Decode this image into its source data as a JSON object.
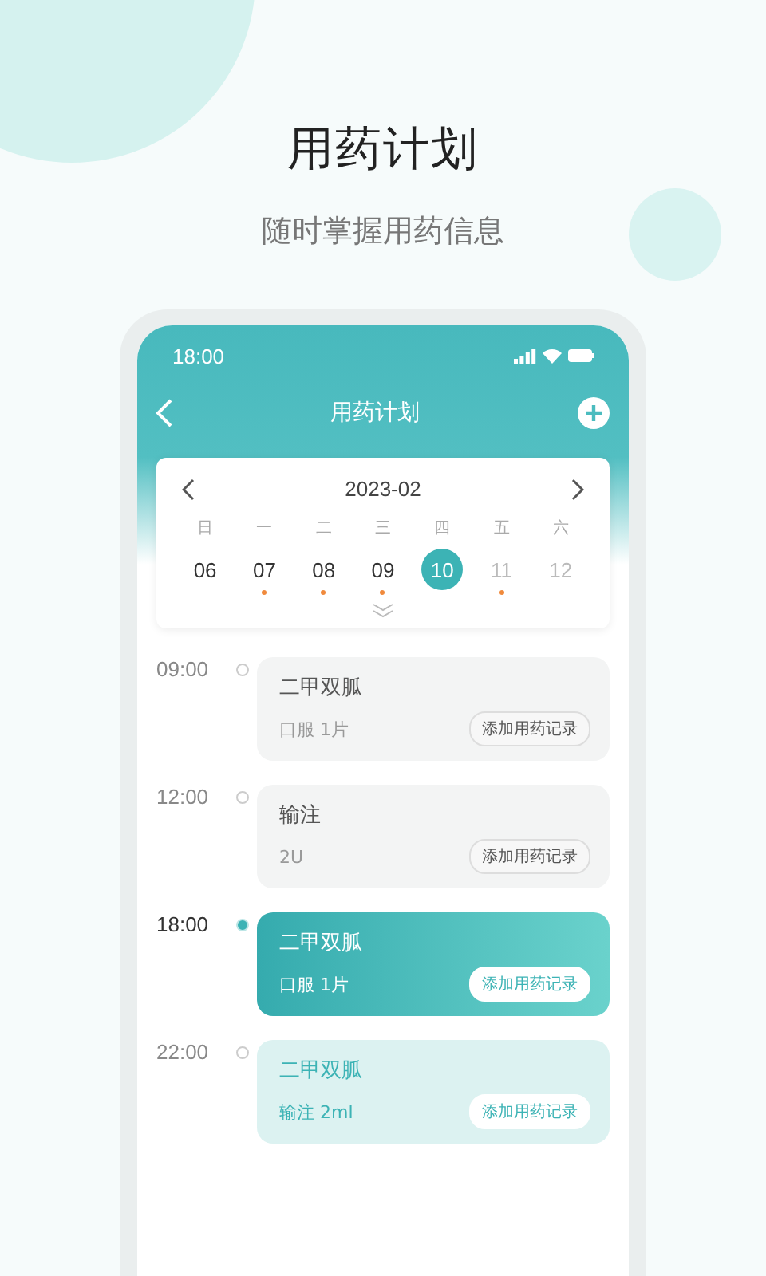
{
  "headline": "用药计划",
  "subheadline": "随时掌握用药信息",
  "status_bar": {
    "time": "18:00"
  },
  "nav": {
    "title": "用药计划"
  },
  "calendar": {
    "month": "2023-02",
    "weekdays": [
      "日",
      "一",
      "二",
      "三",
      "四",
      "五",
      "六"
    ],
    "days": [
      {
        "label": "06",
        "selected": false,
        "dimmed": false,
        "dot": false
      },
      {
        "label": "07",
        "selected": false,
        "dimmed": false,
        "dot": true
      },
      {
        "label": "08",
        "selected": false,
        "dimmed": false,
        "dot": true
      },
      {
        "label": "09",
        "selected": false,
        "dimmed": false,
        "dot": true
      },
      {
        "label": "10",
        "selected": true,
        "dimmed": false,
        "dot": false
      },
      {
        "label": "11",
        "selected": false,
        "dimmed": true,
        "dot": true
      },
      {
        "label": "12",
        "selected": false,
        "dimmed": true,
        "dot": false
      }
    ]
  },
  "schedule": [
    {
      "time": "09:00",
      "kind": "past",
      "name": "二甲双胍",
      "dose": "口服 1片",
      "action": "添加用药记录"
    },
    {
      "time": "12:00",
      "kind": "past",
      "name": "输注",
      "dose": "2U",
      "action": "添加用药记录"
    },
    {
      "time": "18:00",
      "kind": "current",
      "name": "二甲双胍",
      "dose": "口服 1片",
      "action": "添加用药记录"
    },
    {
      "time": "22:00",
      "kind": "upcoming",
      "name": "二甲双胍",
      "dose": "输注 2ml",
      "action": "添加用药记录"
    }
  ]
}
